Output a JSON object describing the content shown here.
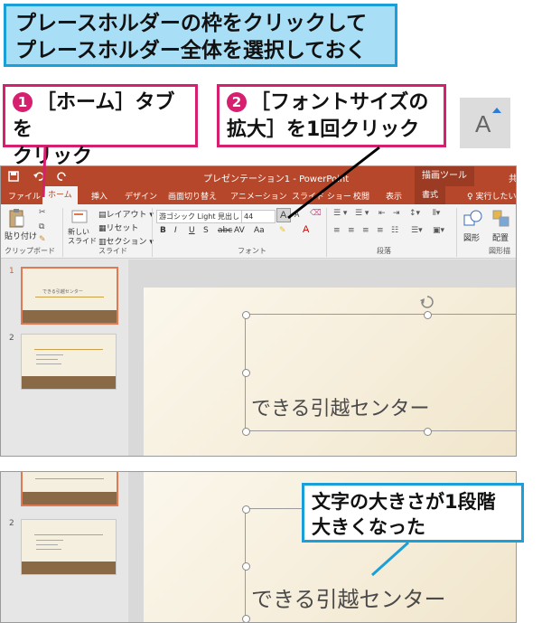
{
  "step_title_line1": "プレースホルダーの枠をクリックして",
  "step_title_line2": "プレースホルダー全体を選択しておく",
  "callout1": {
    "num": "1",
    "line1": "［ホーム］タブを",
    "line2": "クリック"
  },
  "callout2": {
    "num": "2",
    "line1": "［フォントサイズの",
    "line2": "拡大］を1回クリック"
  },
  "enlarge_icon_glyph": "A",
  "result_callout": {
    "line1": "文字の大きさが1段階",
    "line2": "大きくなった"
  },
  "titlebar": {
    "doc_title": "プレゼンテーション1 - PowerPoint",
    "context_tab": "描画ツール",
    "cut_off": "共"
  },
  "tabs": [
    "ファイル",
    "ホーム",
    "挿入",
    "デザイン",
    "画面切り替え",
    "アニメーション",
    "スライド ショー",
    "校閲",
    "表示",
    "書式",
    "実行したい"
  ],
  "ribbon": {
    "paste_label": "貼り付け",
    "clipboard_group": "クリップボード",
    "layout_label": "レイアウト",
    "reset_label": "リセット",
    "new_slide_label": "新しい\nスライド",
    "section_label": "セクション",
    "slides_group": "スライド",
    "font_name": "游ゴシック Light 見出し",
    "font_size": "44",
    "font_group": "フォント",
    "paragraph_group": "段落",
    "shapes_label": "図形",
    "arrange_label": "配置",
    "drawing_group": "図形描"
  },
  "thumbnails": [
    {
      "number": "1",
      "title": "できる引越センター"
    },
    {
      "number": "2"
    }
  ],
  "slide_text_before": "できる引越センター",
  "slide_text_after": "できる引越センター",
  "colors": {
    "accent_blue": "#1b9fd9",
    "callout_pink": "#d6206f",
    "ppt_orange": "#b7472a"
  }
}
